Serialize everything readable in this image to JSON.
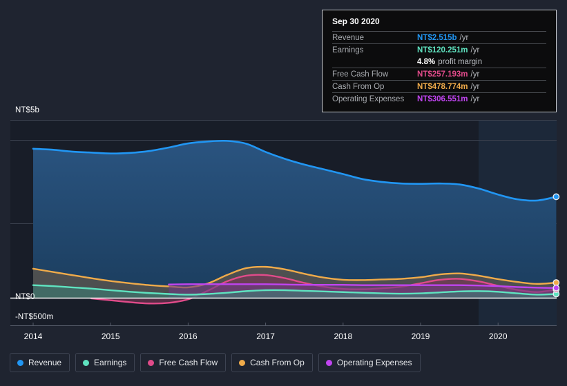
{
  "chart_data": {
    "type": "area",
    "title": "",
    "xlabel": "",
    "ylabel": "",
    "currency": "NT$",
    "grid": true,
    "legend_position": "bottom",
    "x": [
      2014.0,
      2014.25,
      2014.5,
      2014.75,
      2015.0,
      2015.25,
      2015.5,
      2015.75,
      2016.0,
      2016.25,
      2016.5,
      2016.75,
      2017.0,
      2017.25,
      2017.5,
      2017.75,
      2018.0,
      2018.25,
      2018.5,
      2018.75,
      2019.0,
      2019.25,
      2019.5,
      2019.75,
      2020.0,
      2020.25,
      2020.5,
      2020.75
    ],
    "x_ticks": [
      "2014",
      "2015",
      "2016",
      "2017",
      "2018",
      "2019",
      "2020"
    ],
    "y_ticks": [
      "NT$5b",
      "NT$0",
      "-NT$500m"
    ],
    "ylim": [
      -0.5,
      5.6
    ],
    "gridline_values": [
      5.6,
      5.0,
      2.35,
      0.0
    ],
    "zero_line_value": 0,
    "forecast_start_x": 2020.0,
    "series": [
      {
        "name": "Revenue",
        "color": "#2196f3",
        "fill": "#22496f",
        "values": [
          4.72,
          4.69,
          4.63,
          4.6,
          4.57,
          4.59,
          4.65,
          4.76,
          4.89,
          4.95,
          4.97,
          4.88,
          4.62,
          4.4,
          4.22,
          4.07,
          3.92,
          3.76,
          3.67,
          3.62,
          3.61,
          3.62,
          3.59,
          3.46,
          3.27,
          3.12,
          3.08,
          3.2
        ],
        "end_value": 2.515,
        "end_label": "NT$2.515b"
      },
      {
        "name": "Earnings",
        "color": "#5fe3c0",
        "fill": "#3c7c72",
        "values": [
          0.4,
          0.37,
          0.33,
          0.29,
          0.24,
          0.19,
          0.15,
          0.12,
          0.1,
          0.12,
          0.16,
          0.21,
          0.24,
          0.24,
          0.22,
          0.2,
          0.18,
          0.16,
          0.14,
          0.13,
          0.14,
          0.17,
          0.2,
          0.21,
          0.19,
          0.14,
          0.1,
          0.12
        ],
        "end_value": 0.120251,
        "end_label": "NT$120.251m"
      },
      {
        "name": "Free Cash Flow",
        "color": "#e14b8a",
        "fill": "#7a3655",
        "values": [
          null,
          null,
          null,
          -0.02,
          -0.08,
          -0.14,
          -0.18,
          -0.16,
          -0.05,
          0.22,
          0.52,
          0.7,
          0.72,
          0.62,
          0.47,
          0.35,
          0.28,
          0.27,
          0.3,
          0.35,
          0.46,
          0.57,
          0.6,
          0.52,
          0.38,
          0.25,
          0.18,
          0.26
        ],
        "end_value": 0.257193,
        "end_label": "NT$257.193m"
      },
      {
        "name": "Cash From Op",
        "color": "#f0ab4a",
        "fill": "#6e5a44",
        "values": [
          0.92,
          0.82,
          0.72,
          0.62,
          0.53,
          0.46,
          0.4,
          0.36,
          0.33,
          0.45,
          0.72,
          0.94,
          0.98,
          0.9,
          0.76,
          0.64,
          0.57,
          0.56,
          0.58,
          0.6,
          0.65,
          0.74,
          0.77,
          0.7,
          0.59,
          0.5,
          0.44,
          0.48
        ]
      },
      {
        "name": "Operating Expenses",
        "color": "#c044f0",
        "fill": "#6c3c82",
        "values": [
          null,
          null,
          null,
          null,
          null,
          null,
          null,
          0.42,
          0.43,
          0.43,
          0.43,
          0.43,
          0.43,
          0.42,
          0.41,
          0.41,
          0.41,
          0.4,
          0.4,
          0.4,
          0.4,
          0.4,
          0.4,
          0.39,
          0.37,
          0.34,
          0.32,
          0.31
        ],
        "end_value": 0.306551,
        "end_label": "NT$306.551m"
      }
    ]
  },
  "tooltip": {
    "title": "Sep 30 2020",
    "rows": [
      {
        "label": "Revenue",
        "value": "NT$2.515b",
        "unit": "/yr",
        "color": "#2196f3"
      },
      {
        "label": "Earnings",
        "value": "NT$120.251m",
        "unit": "/yr",
        "color": "#5fe3c0"
      },
      {
        "label": "",
        "value": "4.8%",
        "unit": "profit margin",
        "color": "#ffffff"
      },
      {
        "label": "Free Cash Flow",
        "value": "NT$257.193m",
        "unit": "/yr",
        "color": "#e14b8a"
      },
      {
        "label": "Cash From Op",
        "value": "NT$478.774m",
        "unit": "/yr",
        "color": "#f0ab4a"
      },
      {
        "label": "Operating Expenses",
        "value": "NT$306.551m",
        "unit": "/yr",
        "color": "#c044f0"
      }
    ]
  },
  "y_axis": {
    "top_label": "NT$5b",
    "zero_label": "NT$0",
    "bottom_label": "-NT$500m"
  },
  "x_axis": {
    "ticks": [
      "2014",
      "2015",
      "2016",
      "2017",
      "2018",
      "2019",
      "2020"
    ]
  },
  "legend": {
    "items": [
      {
        "label": "Revenue",
        "color": "#2196f3"
      },
      {
        "label": "Earnings",
        "color": "#5fe3c0"
      },
      {
        "label": "Free Cash Flow",
        "color": "#e14b8a"
      },
      {
        "label": "Cash From Op",
        "color": "#f0ab4a"
      },
      {
        "label": "Operating Expenses",
        "color": "#c044f0"
      }
    ]
  }
}
